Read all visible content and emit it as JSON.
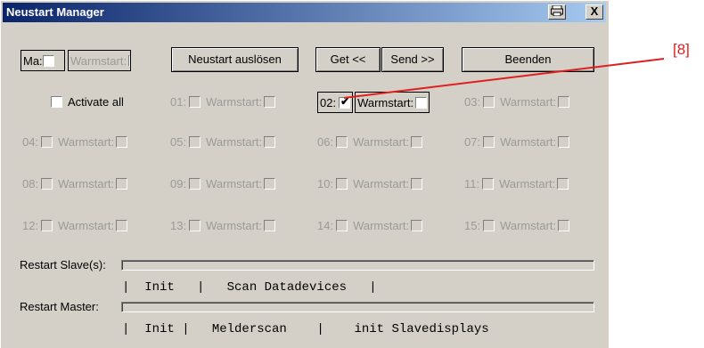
{
  "window": {
    "title": "Neustart Manager",
    "print_icon": "printer-icon",
    "close_label": "X"
  },
  "toolbar": {
    "ma_label": "Ma:",
    "warmstart_label": "Warmstart:",
    "restart_button": "Neustart auslösen",
    "get_button": "Get <<",
    "send_button": "Send >>",
    "exit_button": "Beenden"
  },
  "activate_all": "Activate all",
  "slaves": [
    {
      "num": "01:",
      "warm": "Warmstart:",
      "checked": false,
      "enabled": false
    },
    {
      "num": "02:",
      "warm": "Warmstart:",
      "checked": true,
      "enabled": true
    },
    {
      "num": "03:",
      "warm": "Warmstart:",
      "checked": false,
      "enabled": false
    },
    {
      "num": "04:",
      "warm": "Warmstart:",
      "checked": false,
      "enabled": false
    },
    {
      "num": "05:",
      "warm": "Warmstart:",
      "checked": false,
      "enabled": false
    },
    {
      "num": "06:",
      "warm": "Warmstart:",
      "checked": false,
      "enabled": false
    },
    {
      "num": "07:",
      "warm": "Warmstart:",
      "checked": false,
      "enabled": false
    },
    {
      "num": "08:",
      "warm": "Warmstart:",
      "checked": false,
      "enabled": false
    },
    {
      "num": "09:",
      "warm": "Warmstart:",
      "checked": false,
      "enabled": false
    },
    {
      "num": "10:",
      "warm": "Warmstart:",
      "checked": false,
      "enabled": false
    },
    {
      "num": "11:",
      "warm": "Warmstart:",
      "checked": false,
      "enabled": false
    },
    {
      "num": "12:",
      "warm": "Warmstart:",
      "checked": false,
      "enabled": false
    },
    {
      "num": "13:",
      "warm": "Warmstart:",
      "checked": false,
      "enabled": false
    },
    {
      "num": "14:",
      "warm": "Warmstart:",
      "checked": false,
      "enabled": false
    },
    {
      "num": "15:",
      "warm": "Warmstart:",
      "checked": false,
      "enabled": false
    }
  ],
  "restart_slaves": {
    "label": "Restart Slave(s):",
    "steps": "|  Init   |   Scan Datadevices   |"
  },
  "restart_master": {
    "label": "Restart Master:",
    "steps": "|  Init |   Melderscan    |    init Slavedisplays"
  },
  "callout": {
    "label": "[8]",
    "color": "#e02020"
  }
}
